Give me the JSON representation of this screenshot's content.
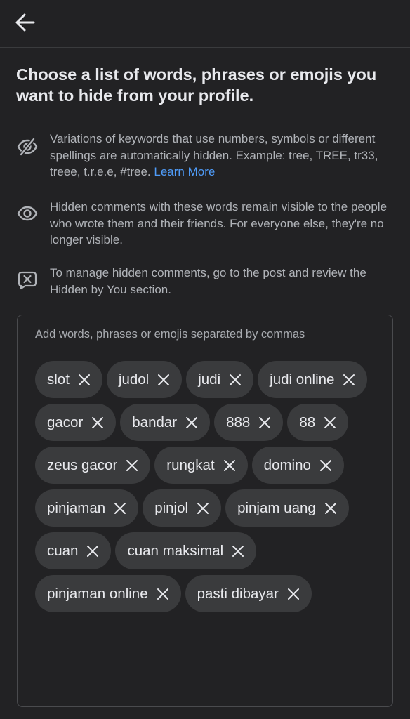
{
  "header": {
    "back_icon": "arrow-left-icon"
  },
  "heading": "Choose a list of words, phrases or emojis you want to hide from your profile.",
  "info": [
    {
      "icon": "eye-slash-icon",
      "text": "Variations of keywords that use numbers, symbols or different spellings are automatically hidden. Example: tree, TREE, tr33, treee, t.r.e.e, #tree.",
      "link": "Learn More"
    },
    {
      "icon": "eye-icon",
      "text": "Hidden comments with these words remain visible to the people who wrote them and their friends. For everyone else, they're no longer visible."
    },
    {
      "icon": "comment-x-icon",
      "text": "To manage hidden comments, go to the post and review the Hidden by You section."
    }
  ],
  "keywords": {
    "placeholder": "Add words, phrases or emojis separated by commas",
    "items": [
      "slot",
      "judol",
      "judi",
      "judi online",
      "gacor",
      "bandar",
      "888",
      "88",
      "zeus gacor",
      "rungkat",
      "domino",
      "pinjaman",
      "pinjol",
      "pinjam uang",
      "cuan",
      "cuan maksimal",
      "pinjaman online",
      "pasti dibayar"
    ],
    "remove_icon": "close-icon"
  },
  "colors": {
    "background": "#222224",
    "chip": "#3a3b3d",
    "link": "#4f9cf9",
    "secondary_text": "#b0b3b8"
  }
}
